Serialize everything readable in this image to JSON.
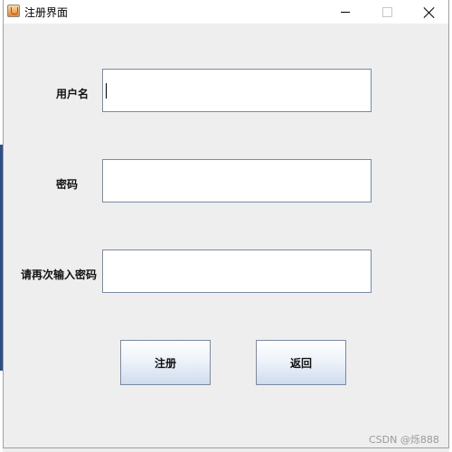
{
  "window": {
    "title": "注册界面"
  },
  "form": {
    "username_label": "用户名",
    "username_value": "",
    "password_label": "密码",
    "password_value": "",
    "confirm_label": "请再次输入密码",
    "confirm_value": ""
  },
  "buttons": {
    "register": "注册",
    "back": "返回"
  },
  "watermark": "CSDN @烁888"
}
